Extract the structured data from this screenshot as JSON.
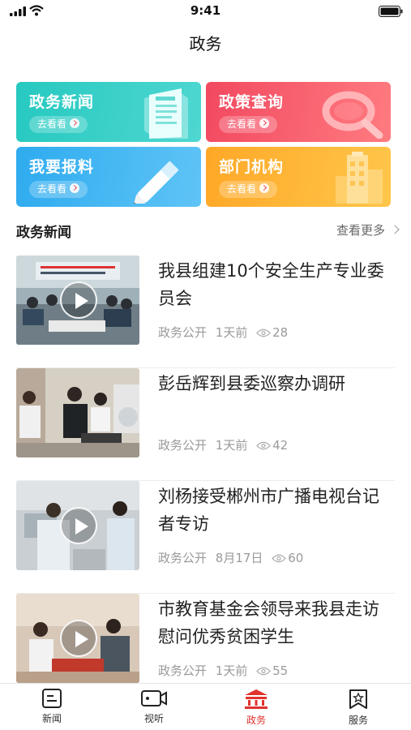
{
  "status_bar": {
    "time": "9:41"
  },
  "nav": {
    "title": "政务"
  },
  "shortcuts": [
    {
      "title": "政务新闻",
      "button": "去看看",
      "icon": "newspaper-icon",
      "color": "#26c9c0"
    },
    {
      "title": "政策查询",
      "button": "去看看",
      "icon": "magnifier-icon",
      "color": "#f24960"
    },
    {
      "title": "我要报料",
      "button": "去看看",
      "icon": "pen-icon",
      "color": "#2eabef"
    },
    {
      "title": "部门机构",
      "button": "去看看",
      "icon": "building-icon",
      "color": "#ffa827"
    }
  ],
  "section": {
    "title": "政务新闻",
    "more": "查看更多"
  },
  "news": [
    {
      "title": "我县组建10个安全生产专业委员会",
      "source": "政务公开",
      "time": "1天前",
      "views": "28",
      "video": true
    },
    {
      "title": "彭岳辉到县委巡察办调研",
      "source": "政务公开",
      "time": "1天前",
      "views": "42",
      "video": false
    },
    {
      "title": "刘杨接受郴州市广播电视台记者专访",
      "source": "政务公开",
      "time": "8月17日",
      "views": "60",
      "video": true
    },
    {
      "title": "市教育基金会领导来我县走访慰问优秀贫困学生",
      "source": "政务公开",
      "time": "1天前",
      "views": "55",
      "video": true
    }
  ],
  "tabbar": {
    "active_color": "#e0322e",
    "items": [
      {
        "label": "新闻",
        "icon": "news-icon"
      },
      {
        "label": "视听",
        "icon": "video-icon"
      },
      {
        "label": "政务",
        "icon": "government-icon",
        "active": true
      },
      {
        "label": "服务",
        "icon": "service-icon"
      }
    ]
  }
}
